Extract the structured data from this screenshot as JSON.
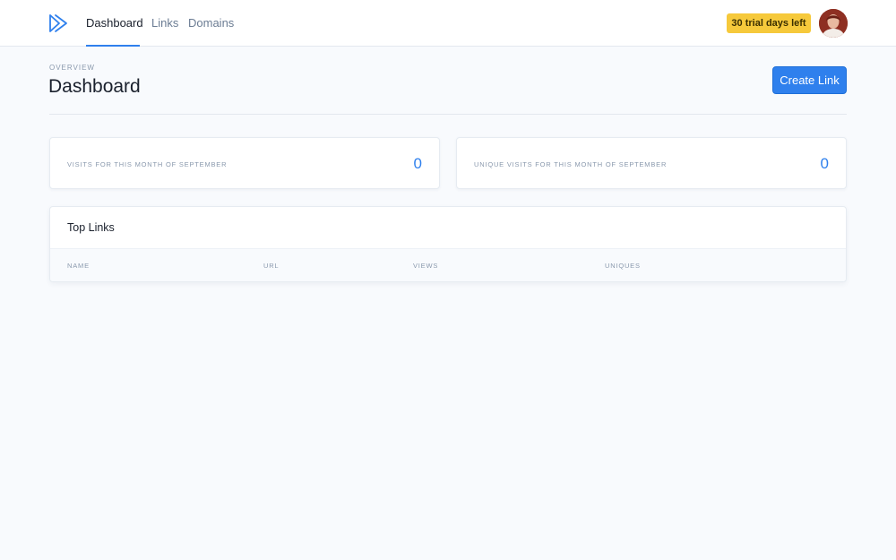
{
  "header": {
    "logo_icon": "play-chevron-logo-icon",
    "nav": [
      {
        "label": "Dashboard",
        "active": true
      },
      {
        "label": "Links",
        "active": false
      },
      {
        "label": "Domains",
        "active": false
      }
    ],
    "trial_badge": "30 trial days left",
    "avatar_icon": "user-avatar-icon"
  },
  "page": {
    "overline": "OVERVIEW",
    "title": "Dashboard",
    "create_button": "Create Link"
  },
  "stats": [
    {
      "label": "VISITS FOR THIS MONTH OF SEPTEMBER",
      "value": "0"
    },
    {
      "label": "UNIQUE VISITS FOR THIS MONTH OF SEPTEMBER",
      "value": "0"
    }
  ],
  "top_links": {
    "title": "Top Links",
    "columns": [
      "NAME",
      "URL",
      "VIEWS",
      "UNIQUES"
    ],
    "rows": []
  },
  "colors": {
    "accent": "#2f80ed",
    "badge": "#f6c93b",
    "background": "#f8fafd"
  }
}
